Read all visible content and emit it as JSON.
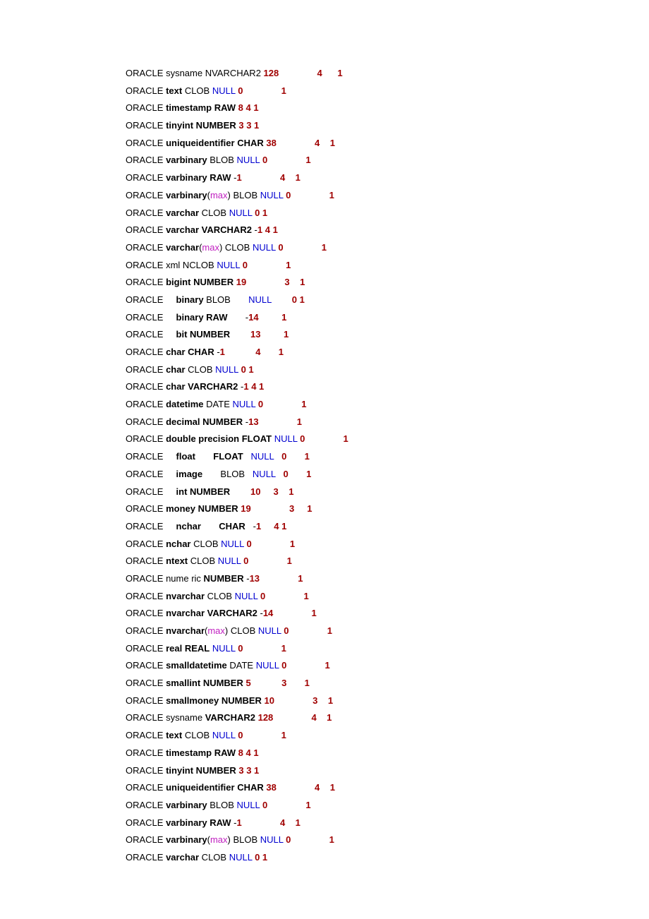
{
  "lines": [
    [
      [
        "plain",
        "ORACLE sysname NVARCHAR2 "
      ],
      [
        "red",
        "128"
      ],
      [
        "plain",
        "               "
      ],
      [
        "red",
        "4"
      ],
      [
        "plain",
        "      "
      ],
      [
        "red",
        "1"
      ]
    ],
    [
      [
        "plain",
        "ORACLE "
      ],
      [
        "bold",
        "text"
      ],
      [
        "plain",
        " CLOB "
      ],
      [
        "blue",
        "NULL"
      ],
      [
        "plain",
        " "
      ],
      [
        "red",
        "0"
      ],
      [
        "plain",
        "               "
      ],
      [
        "red",
        "1"
      ]
    ],
    [
      [
        "plain",
        "ORACLE "
      ],
      [
        "bold",
        "timestamp RAW"
      ],
      [
        "plain",
        " "
      ],
      [
        "red",
        "8 4 1"
      ]
    ],
    [
      [
        "plain",
        "ORACLE "
      ],
      [
        "bold",
        "tinyint NUMBER"
      ],
      [
        "plain",
        " "
      ],
      [
        "red",
        "3 3 1"
      ]
    ],
    [
      [
        "plain",
        "ORACLE "
      ],
      [
        "bold",
        "uniqueidentifier CHAR"
      ],
      [
        "plain",
        " "
      ],
      [
        "red",
        "38"
      ],
      [
        "plain",
        "               "
      ],
      [
        "red",
        "4"
      ],
      [
        "plain",
        "    "
      ],
      [
        "red",
        "1"
      ]
    ],
    [
      [
        "plain",
        "ORACLE "
      ],
      [
        "bold",
        "varbinary"
      ],
      [
        "plain",
        " BLOB "
      ],
      [
        "blue",
        "NULL"
      ],
      [
        "plain",
        " "
      ],
      [
        "red",
        "0"
      ],
      [
        "plain",
        "               "
      ],
      [
        "red",
        "1"
      ]
    ],
    [
      [
        "plain",
        "ORACLE "
      ],
      [
        "bold",
        "varbinary RAW"
      ],
      [
        "plain",
        " -"
      ],
      [
        "red",
        "1"
      ],
      [
        "plain",
        "               "
      ],
      [
        "red",
        "4"
      ],
      [
        "plain",
        "    "
      ],
      [
        "red",
        "1"
      ]
    ],
    [
      [
        "plain",
        "ORACLE "
      ],
      [
        "bold",
        "varbinary"
      ],
      [
        "plain",
        "("
      ],
      [
        "pink",
        "max"
      ],
      [
        "plain",
        ") BLOB "
      ],
      [
        "blue",
        "NULL"
      ],
      [
        "plain",
        " "
      ],
      [
        "red",
        "0"
      ],
      [
        "plain",
        "               "
      ],
      [
        "red",
        "1"
      ]
    ],
    [
      [
        "plain",
        "ORACLE "
      ],
      [
        "bold",
        "varchar"
      ],
      [
        "plain",
        " CLOB "
      ],
      [
        "blue",
        "NULL"
      ],
      [
        "plain",
        " "
      ],
      [
        "red",
        "0 1"
      ]
    ],
    [
      [
        "plain",
        "ORACLE "
      ],
      [
        "bold",
        "varchar VARCHAR2"
      ],
      [
        "plain",
        " -"
      ],
      [
        "red",
        "1 4 1"
      ]
    ],
    [
      [
        "plain",
        "ORACLE "
      ],
      [
        "bold",
        "varchar"
      ],
      [
        "plain",
        "("
      ],
      [
        "pink",
        "max"
      ],
      [
        "plain",
        ") CLOB "
      ],
      [
        "blue",
        "NULL"
      ],
      [
        "plain",
        " "
      ],
      [
        "red",
        "0"
      ],
      [
        "plain",
        "               "
      ],
      [
        "red",
        "1"
      ]
    ],
    [
      [
        "plain",
        "ORACLE xml NCLOB "
      ],
      [
        "blue",
        "NULL"
      ],
      [
        "plain",
        " "
      ],
      [
        "red",
        "0"
      ],
      [
        "plain",
        "               "
      ],
      [
        "red",
        "1"
      ]
    ],
    [
      [
        "plain",
        "ORACLE "
      ],
      [
        "bold",
        "bigint NUMBER"
      ],
      [
        "plain",
        " "
      ],
      [
        "red",
        "19"
      ],
      [
        "plain",
        "               "
      ],
      [
        "red",
        "3"
      ],
      [
        "plain",
        "    "
      ],
      [
        "red",
        "1"
      ]
    ],
    [
      [
        "plain",
        "ORACLE     "
      ],
      [
        "bold",
        "binary"
      ],
      [
        "plain",
        " BLOB       "
      ],
      [
        "blue",
        "NULL"
      ],
      [
        "plain",
        "        "
      ],
      [
        "red",
        "0 1"
      ]
    ],
    [
      [
        "plain",
        "ORACLE     "
      ],
      [
        "bold",
        "binary RAW"
      ],
      [
        "plain",
        "       -"
      ],
      [
        "red",
        "14"
      ],
      [
        "plain",
        "         "
      ],
      [
        "red",
        "1"
      ]
    ],
    [
      [
        "plain",
        "ORACLE     "
      ],
      [
        "bold",
        "bit NUMBER"
      ],
      [
        "plain",
        "        "
      ],
      [
        "red",
        "13"
      ],
      [
        "plain",
        "         "
      ],
      [
        "red",
        "1"
      ]
    ],
    [
      [
        "plain",
        "ORACLE "
      ],
      [
        "bold",
        "char CHAR"
      ],
      [
        "plain",
        " -"
      ],
      [
        "red",
        "1"
      ],
      [
        "plain",
        "            "
      ],
      [
        "red",
        "4"
      ],
      [
        "plain",
        "       "
      ],
      [
        "red",
        "1"
      ]
    ],
    [
      [
        "plain",
        "ORACLE "
      ],
      [
        "bold",
        "char"
      ],
      [
        "plain",
        " CLOB "
      ],
      [
        "blue",
        "NULL"
      ],
      [
        "plain",
        " "
      ],
      [
        "red",
        "0 1"
      ]
    ],
    [
      [
        "plain",
        "ORACLE "
      ],
      [
        "bold",
        "char VARCHAR2"
      ],
      [
        "plain",
        " -"
      ],
      [
        "red",
        "1 4 1"
      ]
    ],
    [
      [
        "plain",
        "ORACLE "
      ],
      [
        "bold",
        "datetime"
      ],
      [
        "plain",
        " DATE "
      ],
      [
        "blue",
        "NULL"
      ],
      [
        "plain",
        " "
      ],
      [
        "red",
        "0"
      ],
      [
        "plain",
        "               "
      ],
      [
        "red",
        "1"
      ]
    ],
    [
      [
        "plain",
        "ORACLE "
      ],
      [
        "bold",
        "decimal NUMBER"
      ],
      [
        "plain",
        " -"
      ],
      [
        "red",
        "13"
      ],
      [
        "plain",
        "               "
      ],
      [
        "red",
        "1"
      ]
    ],
    [
      [
        "plain",
        "ORACLE "
      ],
      [
        "bold",
        "double precision FLOAT"
      ],
      [
        "plain",
        " "
      ],
      [
        "blue",
        "NULL"
      ],
      [
        "plain",
        " "
      ],
      [
        "red",
        "0"
      ],
      [
        "plain",
        "               "
      ],
      [
        "red",
        "1"
      ]
    ],
    [
      [
        "plain",
        "ORACLE     "
      ],
      [
        "bold",
        "float"
      ],
      [
        "plain",
        "       "
      ],
      [
        "bold",
        "FLOAT"
      ],
      [
        "plain",
        "   "
      ],
      [
        "blue",
        "NULL"
      ],
      [
        "plain",
        "   "
      ],
      [
        "red",
        "0"
      ],
      [
        "plain",
        "       "
      ],
      [
        "red",
        "1"
      ]
    ],
    [
      [
        "plain",
        "ORACLE     "
      ],
      [
        "bold",
        "image"
      ],
      [
        "plain",
        "       BLOB   "
      ],
      [
        "blue",
        "NULL"
      ],
      [
        "plain",
        "   "
      ],
      [
        "red",
        "0"
      ],
      [
        "plain",
        "       "
      ],
      [
        "red",
        "1"
      ]
    ],
    [
      [
        "plain",
        "ORACLE     "
      ],
      [
        "bold",
        "int NUMBER"
      ],
      [
        "plain",
        "        "
      ],
      [
        "red",
        "10"
      ],
      [
        "plain",
        "     "
      ],
      [
        "red",
        "3"
      ],
      [
        "plain",
        "    "
      ],
      [
        "red",
        "1"
      ]
    ],
    [
      [
        "plain",
        "ORACLE "
      ],
      [
        "bold",
        "money NUMBER"
      ],
      [
        "plain",
        " "
      ],
      [
        "red",
        "19"
      ],
      [
        "plain",
        "               "
      ],
      [
        "red",
        "3"
      ],
      [
        "plain",
        "     "
      ],
      [
        "red",
        "1"
      ]
    ],
    [
      [
        "plain",
        "ORACLE     "
      ],
      [
        "bold",
        "nchar"
      ],
      [
        "plain",
        "       "
      ],
      [
        "bold",
        "CHAR"
      ],
      [
        "plain",
        "   -"
      ],
      [
        "red",
        "1"
      ],
      [
        "plain",
        "     "
      ],
      [
        "red",
        "4 1"
      ]
    ],
    [
      [
        "plain",
        "ORACLE "
      ],
      [
        "bold",
        "nchar"
      ],
      [
        "plain",
        " CLOB "
      ],
      [
        "blue",
        "NULL"
      ],
      [
        "plain",
        " "
      ],
      [
        "red",
        "0"
      ],
      [
        "plain",
        "               "
      ],
      [
        "red",
        "1"
      ]
    ],
    [
      [
        "plain",
        "ORACLE "
      ],
      [
        "bold",
        "ntext"
      ],
      [
        "plain",
        " CLOB "
      ],
      [
        "blue",
        "NULL"
      ],
      [
        "plain",
        " "
      ],
      [
        "red",
        "0"
      ],
      [
        "plain",
        "               "
      ],
      [
        "red",
        "1"
      ]
    ],
    [
      [
        "plain",
        "ORACLE nume ric "
      ],
      [
        "bold",
        "NUMBER"
      ],
      [
        "plain",
        " -"
      ],
      [
        "red",
        "13"
      ],
      [
        "plain",
        "               "
      ],
      [
        "red",
        "1"
      ]
    ],
    [
      [
        "plain",
        "ORACLE "
      ],
      [
        "bold",
        "nvarchar"
      ],
      [
        "plain",
        " CLOB "
      ],
      [
        "blue",
        "NULL"
      ],
      [
        "plain",
        " "
      ],
      [
        "red",
        "0"
      ],
      [
        "plain",
        "               "
      ],
      [
        "red",
        "1"
      ]
    ],
    [
      [
        "plain",
        "ORACLE "
      ],
      [
        "bold",
        "nvarchar VARCHAR2"
      ],
      [
        "plain",
        " -"
      ],
      [
        "red",
        "14"
      ],
      [
        "plain",
        "               "
      ],
      [
        "red",
        "1"
      ]
    ],
    [
      [
        "plain",
        "ORACLE "
      ],
      [
        "bold",
        "nvarchar"
      ],
      [
        "plain",
        "("
      ],
      [
        "pink",
        "max"
      ],
      [
        "plain",
        ") CLOB "
      ],
      [
        "blue",
        "NULL"
      ],
      [
        "plain",
        " "
      ],
      [
        "red",
        "0"
      ],
      [
        "plain",
        "               "
      ],
      [
        "red",
        "1"
      ]
    ],
    [
      [
        "plain",
        "ORACLE "
      ],
      [
        "bold",
        "real REAL"
      ],
      [
        "plain",
        " "
      ],
      [
        "blue",
        "NULL"
      ],
      [
        "plain",
        " "
      ],
      [
        "red",
        "0"
      ],
      [
        "plain",
        "               "
      ],
      [
        "red",
        "1"
      ]
    ],
    [
      [
        "plain",
        "ORACLE "
      ],
      [
        "bold",
        "smalldatetime"
      ],
      [
        "plain",
        " DATE "
      ],
      [
        "blue",
        "NULL"
      ],
      [
        "plain",
        " "
      ],
      [
        "red",
        "0"
      ],
      [
        "plain",
        "               "
      ],
      [
        "red",
        "1"
      ]
    ],
    [
      [
        "plain",
        "ORACLE "
      ],
      [
        "bold",
        "smallint NUMBER"
      ],
      [
        "plain",
        " "
      ],
      [
        "red",
        "5"
      ],
      [
        "plain",
        "            "
      ],
      [
        "red",
        "3"
      ],
      [
        "plain",
        "       "
      ],
      [
        "red",
        "1"
      ]
    ],
    [
      [
        "plain",
        "ORACLE "
      ],
      [
        "bold",
        "smallmoney NUMBER"
      ],
      [
        "plain",
        " "
      ],
      [
        "red",
        "10"
      ],
      [
        "plain",
        "               "
      ],
      [
        "red",
        "3"
      ],
      [
        "plain",
        "    "
      ],
      [
        "red",
        "1"
      ]
    ],
    [
      [
        "plain",
        "ORACLE sysname "
      ],
      [
        "bold",
        "VARCHAR2"
      ],
      [
        "plain",
        " "
      ],
      [
        "red",
        "128"
      ],
      [
        "plain",
        "               "
      ],
      [
        "red",
        "4"
      ],
      [
        "plain",
        "    "
      ],
      [
        "red",
        "1"
      ]
    ],
    [
      [
        "plain",
        "ORACLE "
      ],
      [
        "bold",
        "text"
      ],
      [
        "plain",
        " CLOB "
      ],
      [
        "blue",
        "NULL"
      ],
      [
        "plain",
        " "
      ],
      [
        "red",
        "0"
      ],
      [
        "plain",
        "               "
      ],
      [
        "red",
        "1"
      ]
    ],
    [
      [
        "plain",
        "ORACLE "
      ],
      [
        "bold",
        "timestamp RAW"
      ],
      [
        "plain",
        " "
      ],
      [
        "red",
        "8 4 1"
      ]
    ],
    [
      [
        "plain",
        "ORACLE "
      ],
      [
        "bold",
        "tinyint NUMBER"
      ],
      [
        "plain",
        " "
      ],
      [
        "red",
        "3 3 1"
      ]
    ],
    [
      [
        "plain",
        "ORACLE "
      ],
      [
        "bold",
        "uniqueidentifier CHAR"
      ],
      [
        "plain",
        " "
      ],
      [
        "red",
        "38"
      ],
      [
        "plain",
        "               "
      ],
      [
        "red",
        "4"
      ],
      [
        "plain",
        "    "
      ],
      [
        "red",
        "1"
      ]
    ],
    [
      [
        "plain",
        "ORACLE "
      ],
      [
        "bold",
        "varbinary"
      ],
      [
        "plain",
        " BLOB "
      ],
      [
        "blue",
        "NULL"
      ],
      [
        "plain",
        " "
      ],
      [
        "red",
        "0"
      ],
      [
        "plain",
        "               "
      ],
      [
        "red",
        "1"
      ]
    ],
    [
      [
        "plain",
        "ORACLE "
      ],
      [
        "bold",
        "varbinary RAW"
      ],
      [
        "plain",
        " -"
      ],
      [
        "red",
        "1"
      ],
      [
        "plain",
        "               "
      ],
      [
        "red",
        "4"
      ],
      [
        "plain",
        "    "
      ],
      [
        "red",
        "1"
      ]
    ],
    [
      [
        "plain",
        "ORACLE "
      ],
      [
        "bold",
        "varbinary"
      ],
      [
        "plain",
        "("
      ],
      [
        "pink",
        "max"
      ],
      [
        "plain",
        ") BLOB "
      ],
      [
        "blue",
        "NULL"
      ],
      [
        "plain",
        " "
      ],
      [
        "red",
        "0"
      ],
      [
        "plain",
        "               "
      ],
      [
        "red",
        "1"
      ]
    ],
    [
      [
        "plain",
        "ORACLE "
      ],
      [
        "bold",
        "varchar"
      ],
      [
        "plain",
        " CLOB "
      ],
      [
        "blue",
        "NULL"
      ],
      [
        "plain",
        " "
      ],
      [
        "red",
        "0 1"
      ]
    ]
  ]
}
